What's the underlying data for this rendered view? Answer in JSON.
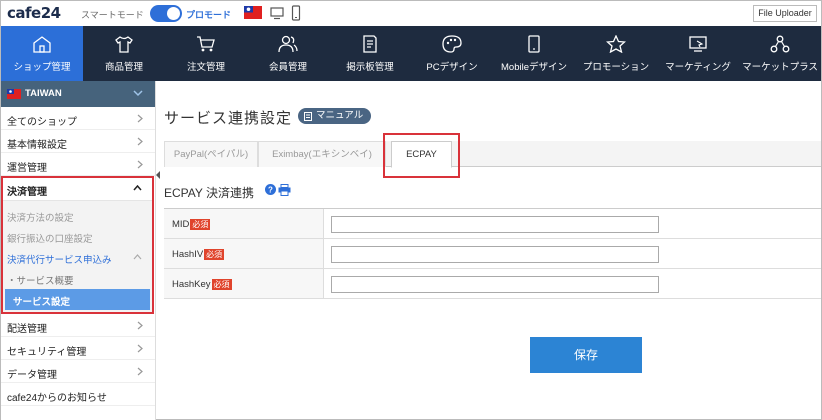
{
  "topbar": {
    "logo": "cafe24",
    "smart_mode_label": "スマートモード",
    "pro_mode_label": "プロモード",
    "file_uploader": "File Uploader"
  },
  "nav": {
    "items": [
      {
        "label": "ショップ管理",
        "icon": "home-icon",
        "active": true
      },
      {
        "label": "商品管理",
        "icon": "shirt-icon"
      },
      {
        "label": "注文管理",
        "icon": "cart-icon"
      },
      {
        "label": "会員管理",
        "icon": "users-icon"
      },
      {
        "label": "掲示板管理",
        "icon": "board-icon"
      },
      {
        "label": "PCデザイン",
        "icon": "palette-icon"
      },
      {
        "label": "Mobileデザイン",
        "icon": "mobile-icon"
      },
      {
        "label": "プロモーション",
        "icon": "star-icon"
      },
      {
        "label": "マーケティング",
        "icon": "marketing-icon"
      },
      {
        "label": "マーケットプラス",
        "icon": "network-icon"
      }
    ]
  },
  "sidebar": {
    "region": "TAIWAN",
    "items_top": [
      "全てのショップ",
      "基本情報設定",
      "運営管理"
    ],
    "group": {
      "title": "決済管理",
      "subs": [
        "決済方法の設定",
        "銀行振込の口座設定"
      ],
      "expanded_sub": "決済代行サービス申込み",
      "subsubs": [
        "・サービス概要",
        "サービス設定"
      ]
    },
    "items_bottom": [
      "配送管理",
      "セキュリティ管理",
      "データ管理",
      "cafe24からのお知らせ"
    ]
  },
  "main": {
    "title": "サービス連携設定",
    "manual_button": "マニュアル",
    "tabs": [
      "PayPal(ペイパル)",
      "Eximbay(エキシンベイ)",
      "ECPAY"
    ],
    "section_title": "ECPAY 決済連携",
    "required_badge": "必須",
    "fields": [
      {
        "label": "MID",
        "value": ""
      },
      {
        "label": "HashIV",
        "value": ""
      },
      {
        "label": "HashKey",
        "value": ""
      }
    ],
    "save_button": "保存"
  },
  "colors": {
    "nav_bg": "#1e2b3f",
    "nav_active": "#2c6fd8",
    "highlight": "#d9323a",
    "save": "#2c84d4"
  }
}
